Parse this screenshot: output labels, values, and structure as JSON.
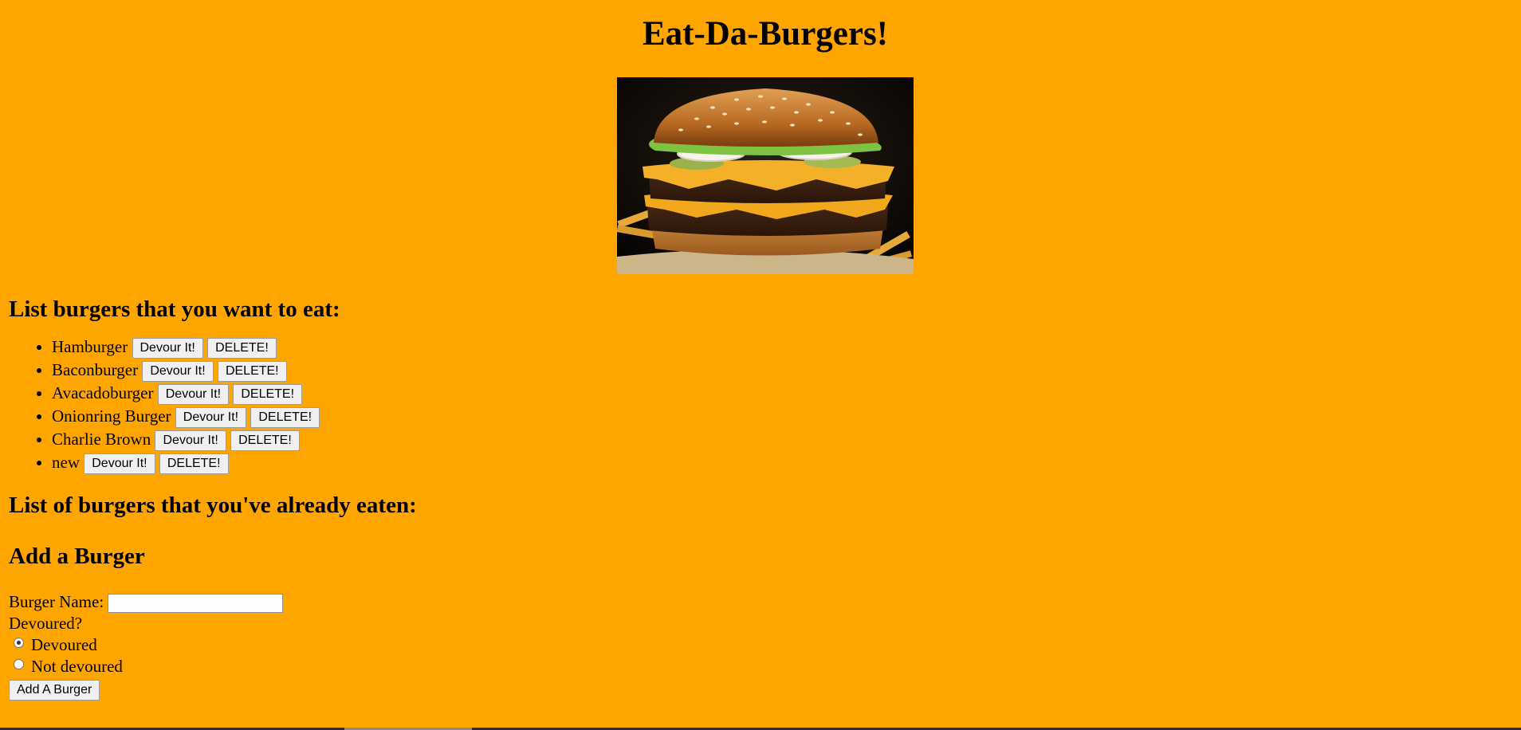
{
  "page": {
    "title": "Eat-Da-Burgers!",
    "background_color": "#FFA500"
  },
  "hero_image": {
    "subject": "double-cheeseburger-photo"
  },
  "want_to_eat": {
    "heading": "List burgers that you want to eat:",
    "devour_label": "Devour It!",
    "delete_label": "DELETE!",
    "items": [
      {
        "name": "Hamburger"
      },
      {
        "name": "Baconburger"
      },
      {
        "name": "Avacadoburger"
      },
      {
        "name": "Onionring Burger"
      },
      {
        "name": "Charlie Brown"
      },
      {
        "name": "new"
      }
    ]
  },
  "eaten": {
    "heading": "List of burgers that you've already eaten:",
    "items": []
  },
  "add_form": {
    "heading": "Add a Burger",
    "name_label": "Burger Name:",
    "name_value": "",
    "devoured_label": "Devoured?",
    "options": [
      {
        "label": "Devoured",
        "checked": true
      },
      {
        "label": "Not devoured",
        "checked": false
      }
    ],
    "submit_label": "Add A Burger"
  }
}
